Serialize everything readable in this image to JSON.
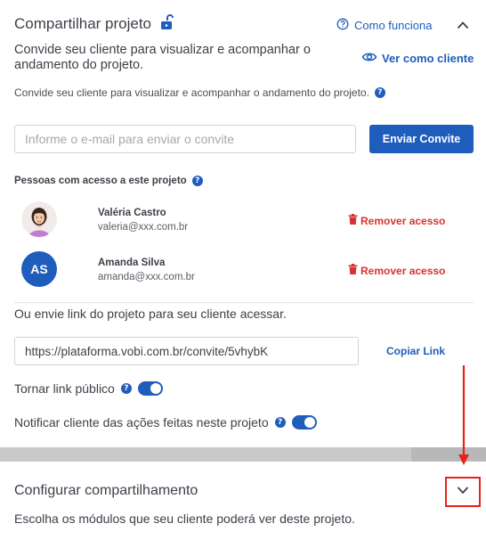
{
  "header": {
    "title": "Compartilhar projeto",
    "lock_icon": "unlock-icon",
    "how_it_works_label": "Como funciona",
    "collapse_icon": "chevron-up-icon"
  },
  "intro": {
    "description": "Convide seu cliente para visualizar e acompanhar o andamento do projeto.",
    "see_as_client_label": "Ver como cliente",
    "subdescription": "Convide seu cliente para visualizar e acompanhar o andamento do projeto."
  },
  "invite": {
    "email_placeholder": "Informe o e-mail para enviar o convite",
    "email_value": "",
    "send_label": "Enviar Convite"
  },
  "access": {
    "title": "Pessoas com acesso a este projeto",
    "people": [
      {
        "name": "Valéria Castro",
        "email": "valeria@xxx.com.br",
        "avatar": "photo",
        "remove_label": "Remover acesso"
      },
      {
        "name": "Amanda Silva",
        "email": "amanda@xxx.com.br",
        "avatar": "AS",
        "remove_label": "Remover acesso"
      }
    ]
  },
  "link": {
    "description": "Ou envie link do projeto para seu cliente acessar.",
    "url": "https://plataforma.vobi.com.br/convite/5vhybK",
    "copy_label": "Copiar Link",
    "public_label": "Tornar link público",
    "public_enabled": true,
    "notify_label": "Notificar cliente das ações feitas neste projeto",
    "notify_enabled": true
  },
  "config": {
    "title": "Configurar compartilhamento",
    "description": "Escolha os módulos que seu cliente poderá ver deste projeto.",
    "expand_icon": "chevron-down-icon"
  },
  "colors": {
    "primary": "#1f5dbd",
    "danger": "#d6332e",
    "annotation": "#e5221c",
    "avatar_bg": "#1f5dbd"
  }
}
